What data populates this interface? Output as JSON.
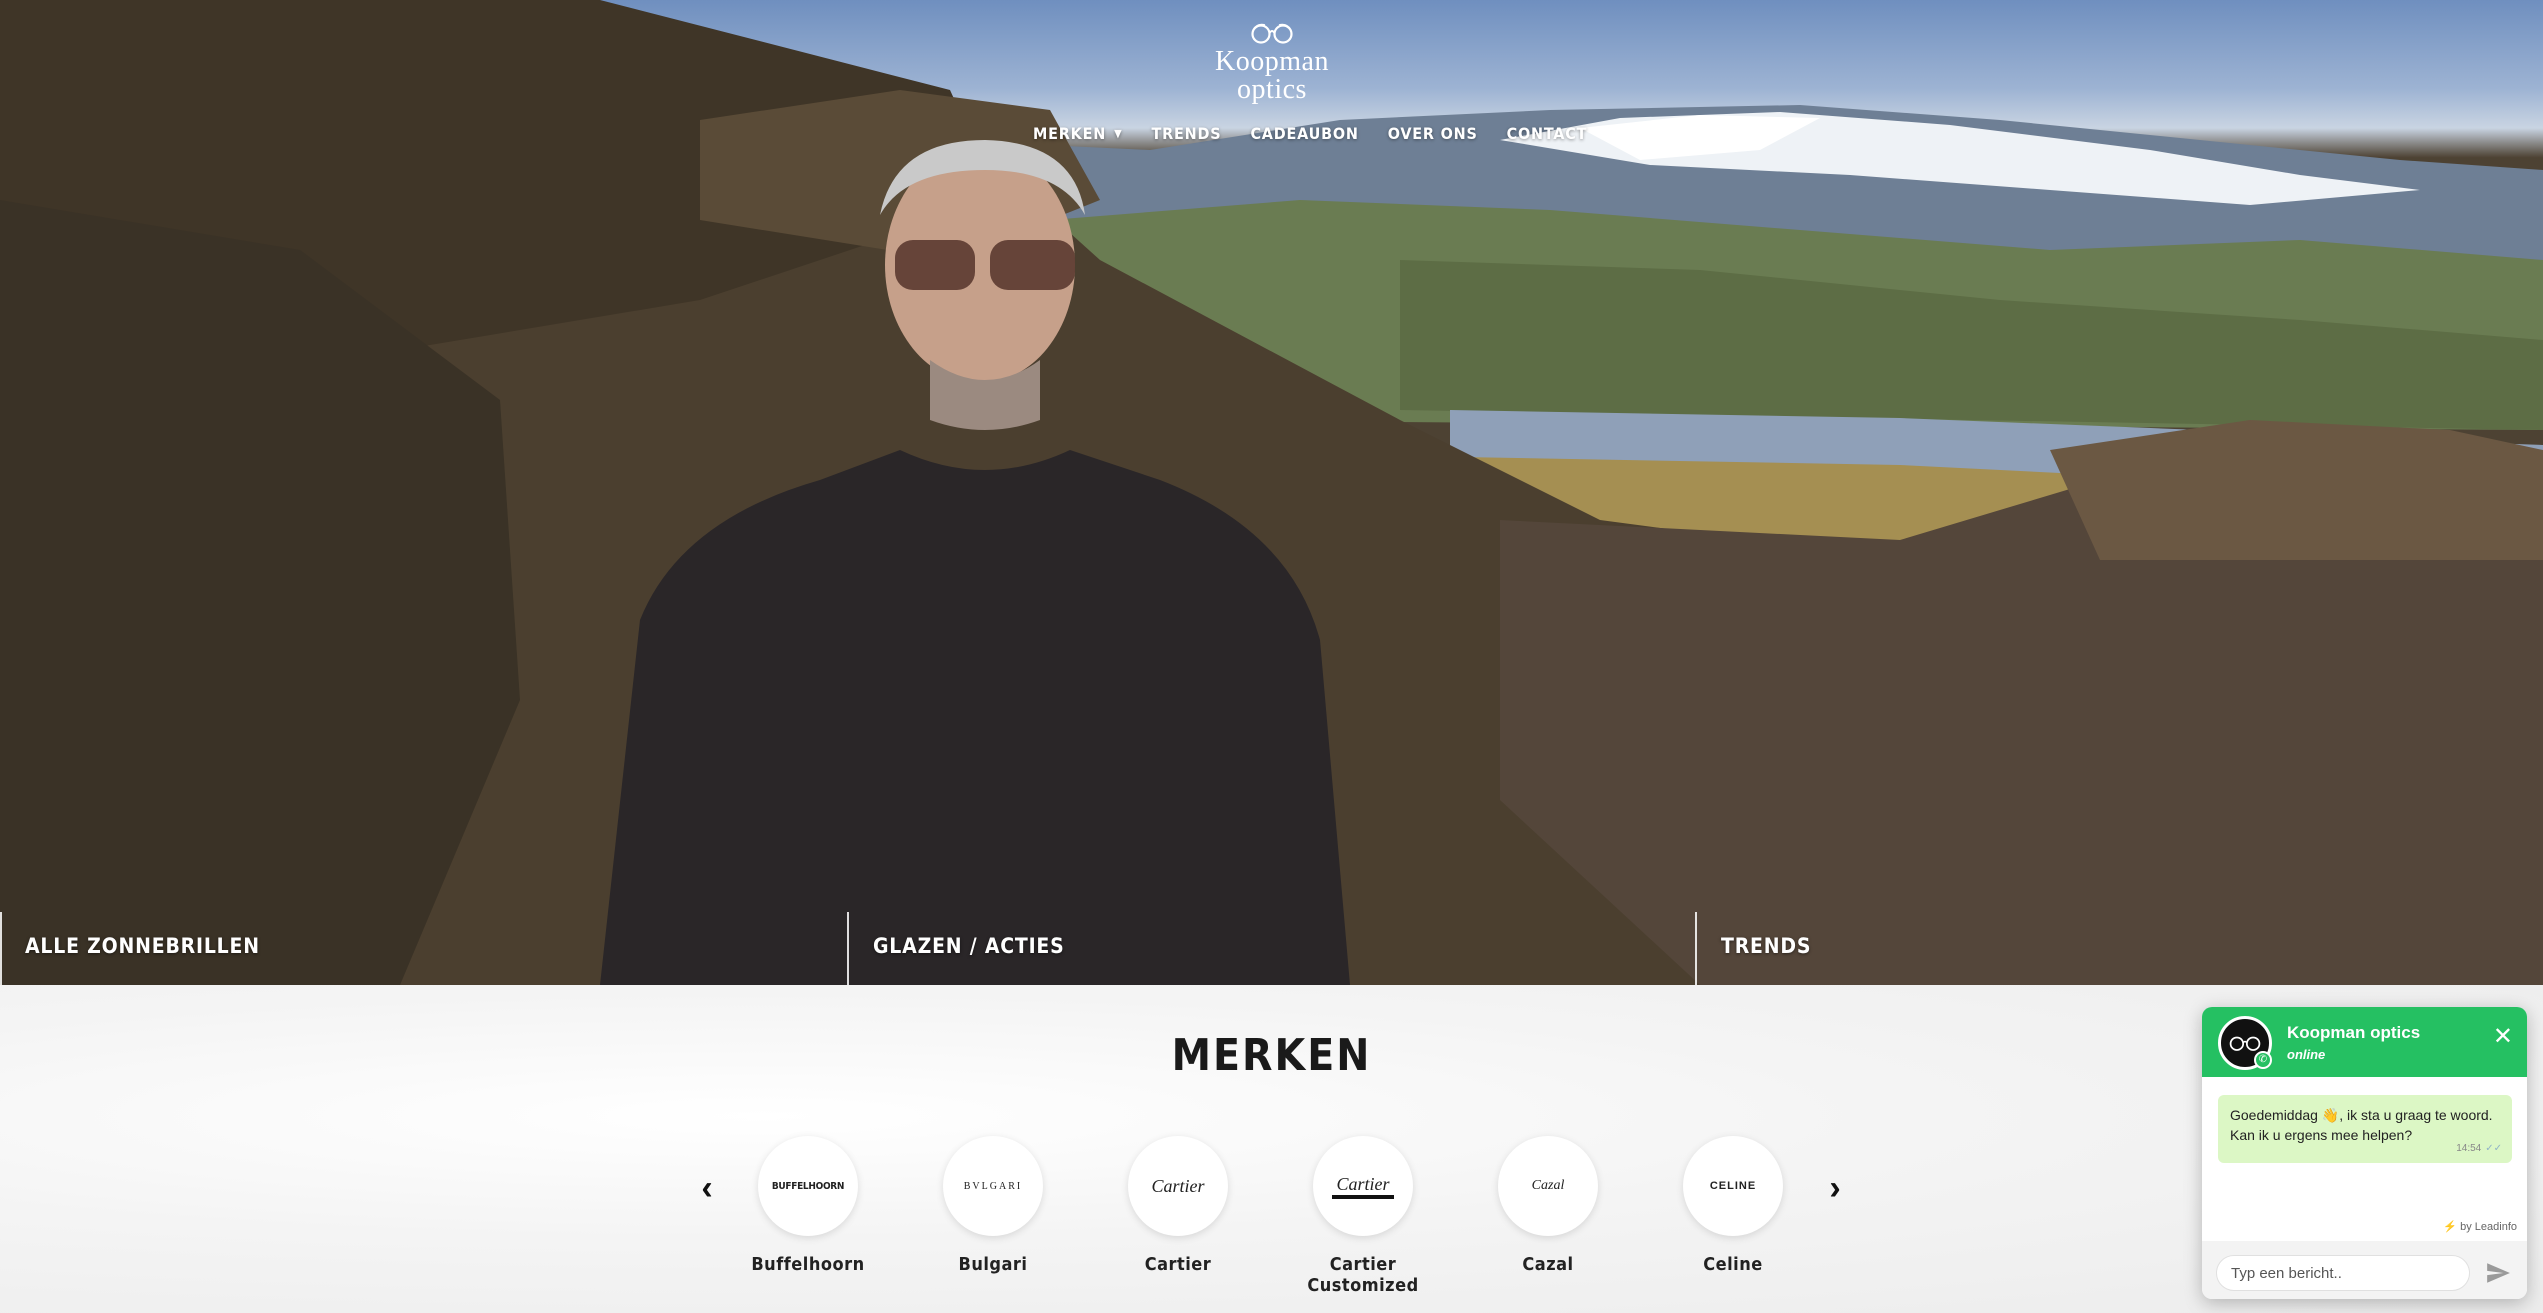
{
  "logo": {
    "line1": "Koopman",
    "line2": "optics"
  },
  "nav": [
    {
      "label": "MERKEN",
      "has_dropdown": true
    },
    {
      "label": "TRENDS"
    },
    {
      "label": "CADEAUBON"
    },
    {
      "label": "OVER ONS"
    },
    {
      "label": "CONTACT"
    }
  ],
  "hero_tiles": [
    {
      "label": "ALLE ZONNEBRILLEN"
    },
    {
      "label": "GLAZEN / ACTIES"
    },
    {
      "label": "TRENDS"
    }
  ],
  "brands": {
    "title": "MERKEN",
    "items": [
      {
        "name": "Buffelhoorn",
        "logo_text": "BUFFELHOORN"
      },
      {
        "name": "Bulgari",
        "logo_text": "BVLGARI"
      },
      {
        "name": "Cartier",
        "logo_text": "Cartier"
      },
      {
        "name": "Cartier Customized",
        "logo_text": "Cartier"
      },
      {
        "name": "Cazal",
        "logo_text": "Cazal"
      },
      {
        "name": "Celine",
        "logo_text": "CELINE"
      }
    ],
    "prev_symbol": "‹",
    "next_symbol": "›"
  },
  "chat": {
    "name": "Koopman optics",
    "status": "online",
    "close_symbol": "✕",
    "message": "Goedemiddag 👋, ik sta u graag te woord. Kan ik u ergens mee helpen?",
    "time": "14:54",
    "ticks": "✓✓",
    "branding": "⚡ by Leadinfo",
    "input_placeholder": "Typ een bericht..",
    "header_color": "#25c062",
    "bubble_color": "#dcf7c5"
  }
}
